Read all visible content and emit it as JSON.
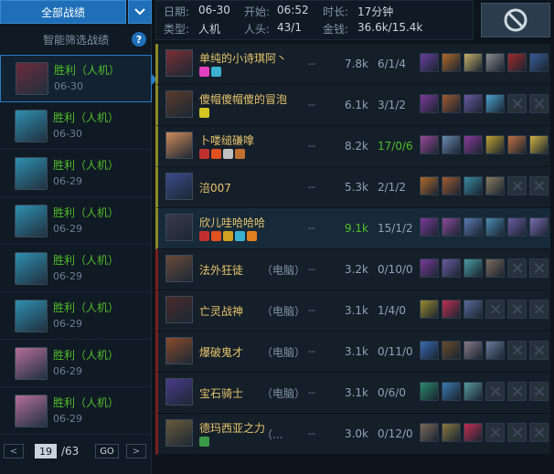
{
  "filter": {
    "label": "全部战绩",
    "smart_label": "智能筛选战绩",
    "help": "?"
  },
  "matches": [
    {
      "result": "胜利",
      "mode": "（人机）",
      "date": "06-30",
      "avatar_color": "#6b2a3a",
      "selected": true
    },
    {
      "result": "胜利",
      "mode": "（人机）",
      "date": "06-30",
      "avatar_color": "#2e8fb0"
    },
    {
      "result": "胜利",
      "mode": "（人机）",
      "date": "06-29",
      "avatar_color": "#2e8fb0"
    },
    {
      "result": "胜利",
      "mode": "（人机）",
      "date": "06-29",
      "avatar_color": "#2e8fb0"
    },
    {
      "result": "胜利",
      "mode": "（人机）",
      "date": "06-29",
      "avatar_color": "#2e8fb0"
    },
    {
      "result": "胜利",
      "mode": "（人机）",
      "date": "06-29",
      "avatar_color": "#2e8fb0"
    },
    {
      "result": "胜利",
      "mode": "（人机）",
      "date": "06-29",
      "avatar_color": "#b46e9a"
    },
    {
      "result": "胜利",
      "mode": "（人机）",
      "date": "06-29",
      "avatar_color": "#b46e9a"
    }
  ],
  "pager": {
    "prev": "<",
    "page": "19",
    "total": "/63",
    "go": "GO",
    "next": ">"
  },
  "info": {
    "date_label": "日期:",
    "date": "06-30",
    "start_label": "开始:",
    "start": "06:52",
    "duration_label": "时长:",
    "duration": "17分钟",
    "type_label": "类型:",
    "type": "人机",
    "kills_label": "人头:",
    "kills": "43/1",
    "gold_label": "金钱:",
    "gold": "36.6k/15.4k"
  },
  "players": [
    {
      "name": "单纯的小诗琪阿丶",
      "tag": "",
      "team": "ally",
      "gold": "7.8k",
      "kda": "6/1/4",
      "gold_hi": false,
      "kda_hi": false,
      "avatar_color": "#7a2e33",
      "badges": [
        "#e040c0",
        "#3bb0d0"
      ],
      "items": [
        "#6b3fa0",
        "#b06a2a",
        "#c9b06a",
        "#8a8a8a",
        "#a02a2a",
        "#3a5c9a"
      ]
    },
    {
      "name": "傻帽傻帽傻的冒泡",
      "tag": "",
      "team": "ally",
      "gold": "6.1k",
      "kda": "3/1/2",
      "gold_hi": false,
      "kda_hi": false,
      "avatar_color": "#5a3a2a",
      "badges": [
        "#d4c420"
      ],
      "items": [
        "#7a3a9a",
        "#a05a30",
        "#6a5aa0",
        "#4aa0d0",
        "",
        ""
      ]
    },
    {
      "name": "卜喽缒磏嗱",
      "tag": "",
      "team": "ally",
      "gold": "8.2k",
      "kda": "17/0/6",
      "gold_hi": false,
      "kda_hi": true,
      "avatar_color": "#d08a5a",
      "badges": [
        "#c03030",
        "#e05020",
        "#c0c0c0",
        "#c07030"
      ],
      "items": [
        "#9a4a9a",
        "#6a8ab0",
        "#8a3a9a",
        "#c0a030",
        "#c07040",
        "#d0b040"
      ]
    },
    {
      "name": "涪007",
      "tag": "",
      "team": "ally",
      "gold": "5.3k",
      "kda": "2/1/2",
      "gold_hi": false,
      "kda_hi": false,
      "avatar_color": "#3a4a8a",
      "badges": [],
      "items": [
        "#b06a2a",
        "#a05a30",
        "#3a8aa0",
        "#8a7a60",
        "",
        ""
      ]
    },
    {
      "name": "欣儿哇哈哈哈",
      "tag": "",
      "team": "ally",
      "me": true,
      "gold": "9.1k",
      "kda": "15/1/2",
      "gold_hi": true,
      "kda_hi": false,
      "avatar_color": "#3a3a4a",
      "badges": [
        "#c03030",
        "#e05020",
        "#d0a020",
        "#3bb0d0",
        "#e08020"
      ],
      "items": [
        "#7a3a9a",
        "#8a4a9a",
        "#5a7ab0",
        "#4a8ab0",
        "#6a5aa0",
        "#7a6ab0"
      ]
    },
    {
      "name": "法外狂徒",
      "tag": "（电脑）",
      "team": "enemy",
      "gold": "3.2k",
      "kda": "0/10/0",
      "gold_hi": false,
      "kda_hi": false,
      "avatar_color": "#6a4a3a",
      "badges": [],
      "items": [
        "#7a3a9a",
        "#6a5aa0",
        "#4a9aa0",
        "#7a6a5a",
        "",
        ""
      ]
    },
    {
      "name": "亡灵战神",
      "tag": "（电脑）",
      "team": "enemy",
      "gold": "3.1k",
      "kda": "1/4/0",
      "gold_hi": false,
      "kda_hi": false,
      "avatar_color": "#4a2a2a",
      "badges": [],
      "items": [
        "#9a8a30",
        "#c03050",
        "#5a6a9a",
        "",
        "",
        ""
      ]
    },
    {
      "name": "爆破鬼才",
      "tag": "（电脑）",
      "team": "enemy",
      "gold": "3.1k",
      "kda": "0/11/0",
      "gold_hi": false,
      "kda_hi": false,
      "avatar_color": "#8a4a2a",
      "badges": [],
      "items": [
        "#3a6ab0",
        "#6a4a2a",
        "#8a7a8a",
        "#6a7a9a",
        "",
        ""
      ]
    },
    {
      "name": "宝石骑士",
      "tag": "（电脑）",
      "team": "enemy",
      "gold": "3.1k",
      "kda": "0/6/0",
      "gold_hi": false,
      "kda_hi": false,
      "avatar_color": "#4a3a8a",
      "badges": [],
      "items": [
        "#2a8a6a",
        "#3a7ab0",
        "#5a9aa0",
        "",
        "",
        ""
      ]
    },
    {
      "name": "德玛西亚之力",
      "tag": "（...",
      "team": "enemy",
      "gold": "3.0k",
      "kda": "0/12/0",
      "gold_hi": false,
      "kda_hi": false,
      "avatar_color": "#6a5a3a",
      "badges": [
        "#3a9a4a"
      ],
      "items": [
        "#7a6a5a",
        "#8a7a40",
        "#c03050",
        "",
        "",
        ""
      ]
    }
  ]
}
